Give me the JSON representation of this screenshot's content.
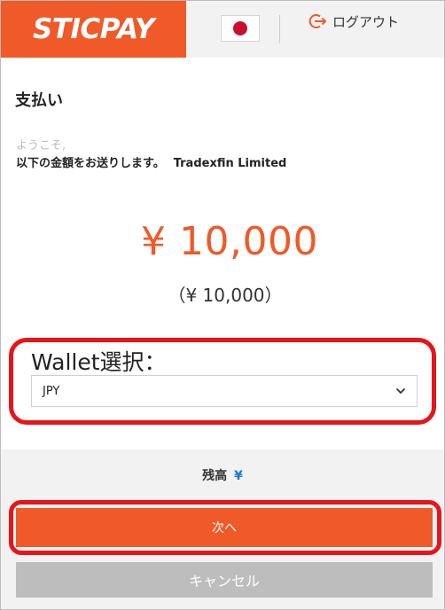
{
  "header": {
    "logo_text": "STICPAY",
    "language_flag": "japan-flag-icon",
    "logout_icon": "logout-icon",
    "logout_label": "ログアウト",
    "brand_color": "#f05a28"
  },
  "payment": {
    "title": "支払い",
    "welcome": "ようこそ,",
    "send_text": "以下の金額をお送りします。",
    "merchant": "Tradexfin Limited",
    "amount": "¥ 10,000",
    "sub_amount": "（¥ 10,000）"
  },
  "wallet": {
    "label": "Wallet選択：",
    "selected": "JPY"
  },
  "balance": {
    "label": "残高",
    "value": "¥"
  },
  "actions": {
    "next_label": "次へ",
    "cancel_label": "キャンセル"
  },
  "colors": {
    "accent": "#f05a28",
    "highlight": "#e8141b",
    "balance_value": "#1c7bd0",
    "cancel_bg": "#bdbdbd"
  }
}
